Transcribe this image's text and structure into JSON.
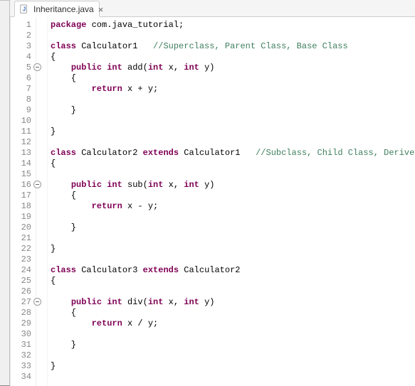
{
  "tab": {
    "title": "Inheritance.java"
  },
  "lines": [
    {
      "n": 1,
      "segs": [
        [
          "package ",
          "kw"
        ],
        [
          "com.java_tutorial;",
          ""
        ]
      ]
    },
    {
      "n": 2,
      "segs": []
    },
    {
      "n": 3,
      "segs": [
        [
          "class",
          "kw"
        ],
        [
          " Calculator1   ",
          ""
        ],
        [
          "//Superclass, Parent Class, Base Class",
          "cm"
        ]
      ]
    },
    {
      "n": 4,
      "segs": [
        [
          "{",
          ""
        ]
      ]
    },
    {
      "n": 5,
      "fold": true,
      "segs": [
        [
          "    ",
          ""
        ],
        [
          "public int",
          "kw"
        ],
        [
          " add(",
          ""
        ],
        [
          "int",
          "kw"
        ],
        [
          " x, ",
          ""
        ],
        [
          "int",
          "kw"
        ],
        [
          " y)",
          ""
        ]
      ]
    },
    {
      "n": 6,
      "segs": [
        [
          "    {",
          ""
        ]
      ]
    },
    {
      "n": 7,
      "segs": [
        [
          "        ",
          ""
        ],
        [
          "return",
          "kw"
        ],
        [
          " x + y;",
          ""
        ]
      ]
    },
    {
      "n": 8,
      "segs": []
    },
    {
      "n": 9,
      "segs": [
        [
          "    }",
          ""
        ]
      ]
    },
    {
      "n": 10,
      "segs": []
    },
    {
      "n": 11,
      "segs": [
        [
          "}",
          ""
        ]
      ]
    },
    {
      "n": 12,
      "segs": []
    },
    {
      "n": 13,
      "segs": [
        [
          "class",
          "kw"
        ],
        [
          " Calculator2 ",
          ""
        ],
        [
          "extends",
          "kw"
        ],
        [
          " Calculator1   ",
          ""
        ],
        [
          "//Subclass, Child Class, Derived Cla",
          "cm"
        ]
      ]
    },
    {
      "n": 14,
      "segs": [
        [
          "{",
          ""
        ]
      ]
    },
    {
      "n": 15,
      "segs": []
    },
    {
      "n": 16,
      "fold": true,
      "segs": [
        [
          "    ",
          ""
        ],
        [
          "public int",
          "kw"
        ],
        [
          " sub(",
          ""
        ],
        [
          "int",
          "kw"
        ],
        [
          " x, ",
          ""
        ],
        [
          "int",
          "kw"
        ],
        [
          " y)",
          ""
        ]
      ]
    },
    {
      "n": 17,
      "segs": [
        [
          "    {",
          ""
        ]
      ]
    },
    {
      "n": 18,
      "segs": [
        [
          "        ",
          ""
        ],
        [
          "return",
          "kw"
        ],
        [
          " x - y;",
          ""
        ]
      ]
    },
    {
      "n": 19,
      "segs": []
    },
    {
      "n": 20,
      "segs": [
        [
          "    }",
          ""
        ]
      ]
    },
    {
      "n": 21,
      "segs": []
    },
    {
      "n": 22,
      "segs": [
        [
          "}",
          ""
        ]
      ]
    },
    {
      "n": 23,
      "segs": []
    },
    {
      "n": 24,
      "segs": [
        [
          "class",
          "kw"
        ],
        [
          " Calculator3 ",
          ""
        ],
        [
          "extends",
          "kw"
        ],
        [
          " Calculator2",
          ""
        ]
      ]
    },
    {
      "n": 25,
      "segs": [
        [
          "{",
          ""
        ]
      ]
    },
    {
      "n": 26,
      "segs": []
    },
    {
      "n": 27,
      "fold": true,
      "segs": [
        [
          "    ",
          ""
        ],
        [
          "public int",
          "kw"
        ],
        [
          " div(",
          ""
        ],
        [
          "int",
          "kw"
        ],
        [
          " x, ",
          ""
        ],
        [
          "int",
          "kw"
        ],
        [
          " y)",
          ""
        ]
      ]
    },
    {
      "n": 28,
      "segs": [
        [
          "    {",
          ""
        ]
      ]
    },
    {
      "n": 29,
      "segs": [
        [
          "        ",
          ""
        ],
        [
          "return",
          "kw"
        ],
        [
          " x / y;",
          ""
        ]
      ]
    },
    {
      "n": 30,
      "segs": []
    },
    {
      "n": 31,
      "segs": [
        [
          "    }",
          ""
        ]
      ]
    },
    {
      "n": 32,
      "segs": []
    },
    {
      "n": 33,
      "segs": [
        [
          "}",
          ""
        ]
      ]
    },
    {
      "n": 34,
      "segs": []
    }
  ]
}
